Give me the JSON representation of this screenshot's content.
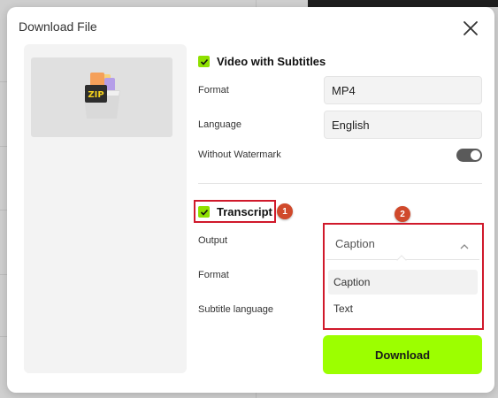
{
  "dialog": {
    "title": "Download File",
    "close_icon": "close-icon"
  },
  "preview": {
    "icon": "zip-archive-icon",
    "icon_text": "ZIP"
  },
  "video_section": {
    "checked": true,
    "label": "Video with Subtitles",
    "format_label": "Format",
    "format_value": "MP4",
    "language_label": "Language",
    "language_value": "English",
    "watermark_label": "Without Watermark",
    "watermark_on": true
  },
  "transcript_section": {
    "checked": true,
    "label": "Transcript",
    "output_label": "Output",
    "output_value": "Caption",
    "format_label": "Format",
    "subtitle_language_label": "Subtitle language",
    "dropdown_options": [
      "Caption",
      "Text"
    ],
    "selected_option": "Caption"
  },
  "annotations": {
    "badge_1": "1",
    "badge_2": "2"
  },
  "actions": {
    "download_label": "Download"
  },
  "colors": {
    "accent": "#9cff00",
    "checkbox": "#8fe000",
    "highlight": "#d0192b",
    "badge": "#d0492b"
  }
}
